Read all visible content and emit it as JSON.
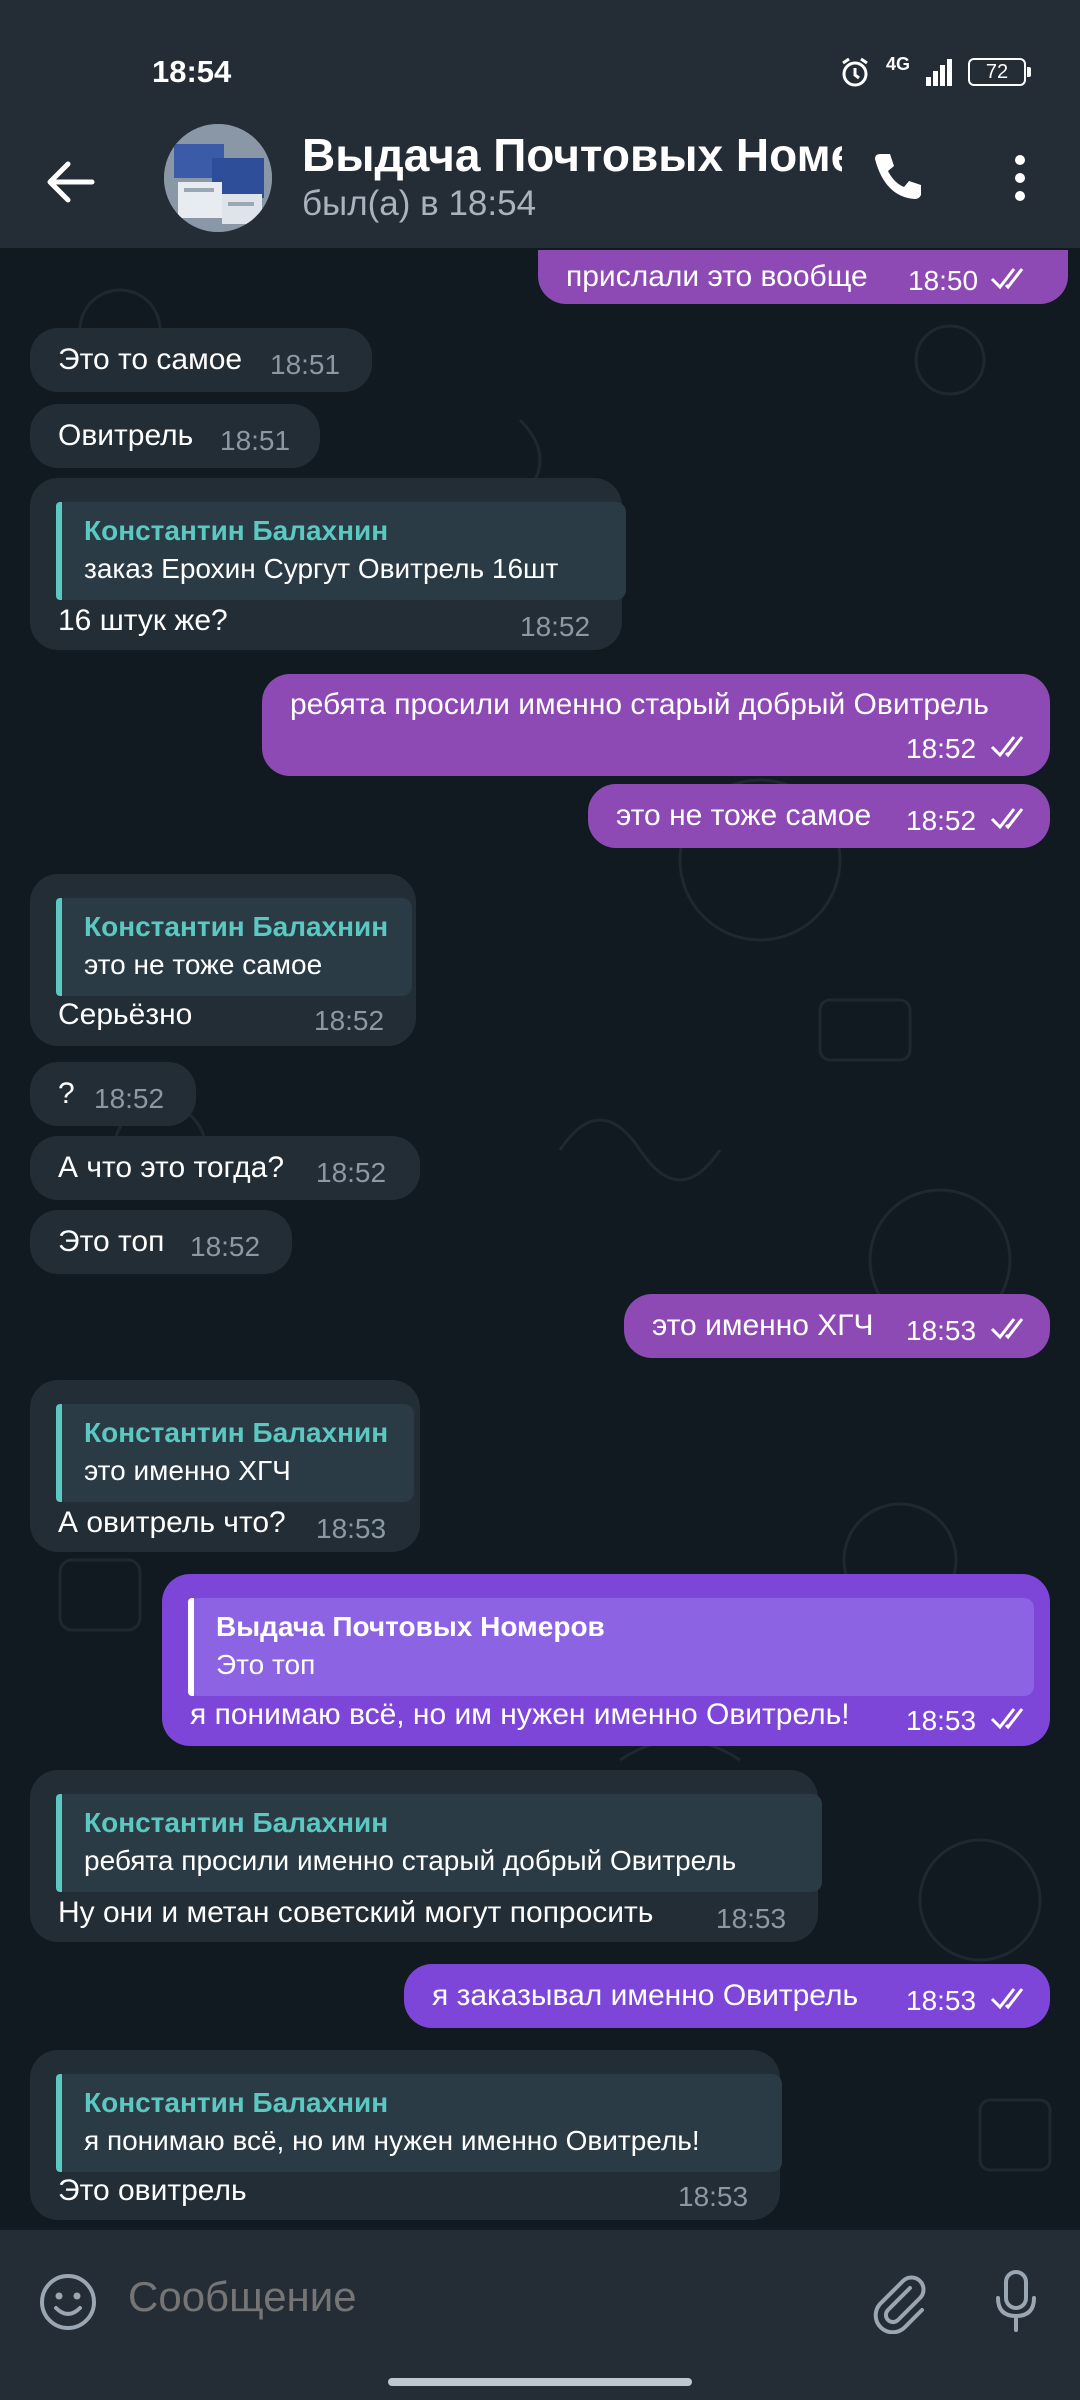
{
  "status_bar": {
    "time": "18:54",
    "network": "4G",
    "battery": "72"
  },
  "header": {
    "title": "Выдача Почтовых Номеров",
    "subtitle": "был(а) в 18:54"
  },
  "composer": {
    "placeholder": "Сообщение"
  },
  "colors": {
    "header": "#242d36",
    "incoming": "#222d35",
    "outgoing": "#8e4ab4",
    "outgoing_alt": "#7e45d9",
    "accent": "#5bc8c2"
  },
  "messages": [
    {
      "dir": "out",
      "text": "прислали это вообще",
      "time": "18:50"
    },
    {
      "dir": "in",
      "text": "Это то самое",
      "time": "18:51"
    },
    {
      "dir": "in",
      "text": "Овитрель",
      "time": "18:51"
    },
    {
      "dir": "in",
      "reply_name": "Константин Балахнин",
      "reply_text": "заказ Ерохин Сургут Овитрель 16шт",
      "text": "16 штук же?",
      "time": "18:52"
    },
    {
      "dir": "out",
      "text": "ребята просили именно старый добрый Овитрель",
      "time": "18:52"
    },
    {
      "dir": "out",
      "text": "это не тоже самое",
      "time": "18:52"
    },
    {
      "dir": "in",
      "reply_name": "Константин Балахнин",
      "reply_text": "это не тоже самое",
      "text": "Серьёзно",
      "time": "18:52"
    },
    {
      "dir": "in",
      "text": "?",
      "time": "18:52"
    },
    {
      "dir": "in",
      "text": "А что это тогда?",
      "time": "18:52"
    },
    {
      "dir": "in",
      "text": "Это топ",
      "time": "18:52"
    },
    {
      "dir": "out",
      "text": "это именно ХГЧ",
      "time": "18:53"
    },
    {
      "dir": "in",
      "reply_name": "Константин Балахнин",
      "reply_text": "это именно ХГЧ",
      "text": "А овитрель что?",
      "time": "18:53"
    },
    {
      "dir": "out",
      "reply_name": "Выдача Почтовых Номеров",
      "reply_text": "Это топ",
      "text": "я понимаю всё, но им нужен именно Овитрель!",
      "time": "18:53"
    },
    {
      "dir": "in",
      "reply_name": "Константин Балахнин",
      "reply_text": "ребята просили именно старый добрый Овитрель",
      "text": "Ну они и метан советский могут попросить",
      "time": "18:53"
    },
    {
      "dir": "out",
      "text": "я заказывал именно Овитрель",
      "time": "18:53"
    },
    {
      "dir": "in",
      "reply_name": "Константин Балахнин",
      "reply_text": "я понимаю всё, но им нужен именно Овитрель!",
      "text": "Это овитрель",
      "time": "18:53"
    }
  ]
}
